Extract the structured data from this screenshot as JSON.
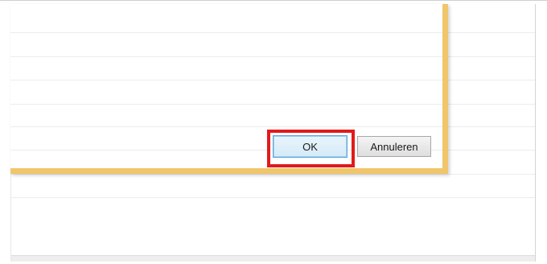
{
  "dialog": {
    "ok_label": "OK",
    "cancel_label": "Annuleren"
  },
  "colors": {
    "dialog_border": "#f1c56a",
    "highlight": "#e21a1a",
    "ok_button_border": "#5fa6d9"
  }
}
